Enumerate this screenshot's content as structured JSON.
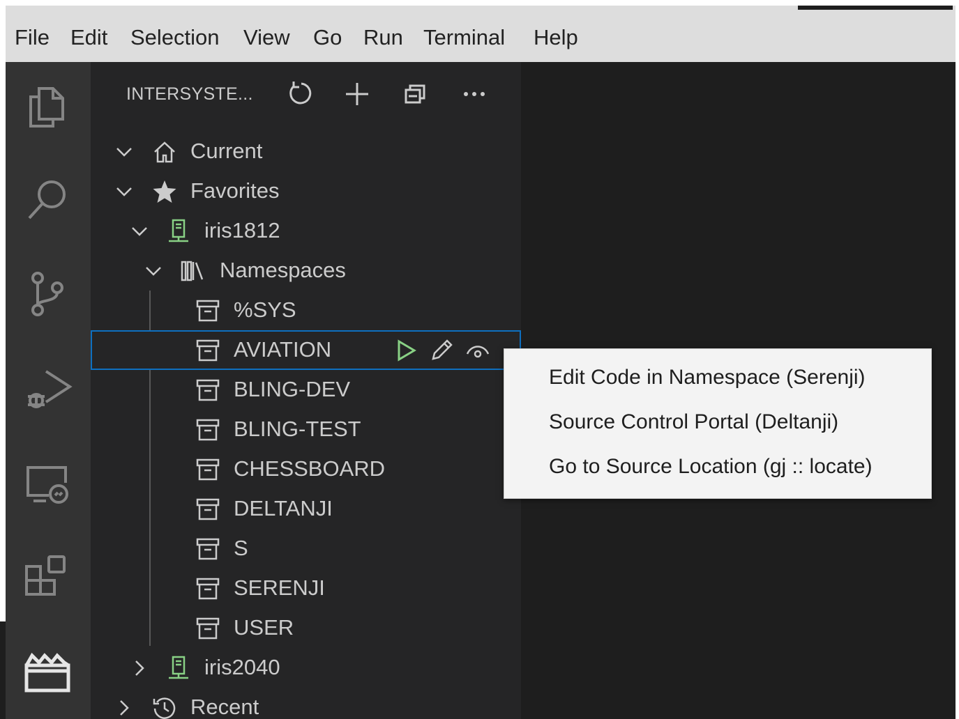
{
  "menu": [
    "File",
    "Edit",
    "Selection",
    "View",
    "Go",
    "Run",
    "Terminal",
    "Help"
  ],
  "activity_bar": [
    {
      "name": "explorer-icon"
    },
    {
      "name": "search-icon"
    },
    {
      "name": "source-control-icon"
    },
    {
      "name": "run-debug-icon"
    },
    {
      "name": "remote-explorer-icon"
    },
    {
      "name": "extensions-icon"
    },
    {
      "name": "intersystems-tools-icon"
    }
  ],
  "sidebar": {
    "title": "INTERSYSTE...",
    "actions": [
      "refresh-icon",
      "add-icon",
      "collapse-all-icon",
      "more-actions-icon"
    ],
    "tree": [
      {
        "label": "Current",
        "icon": "home-icon",
        "chevron": "expanded"
      },
      {
        "label": "Favorites",
        "icon": "star-icon",
        "chevron": "expanded"
      },
      {
        "label": "iris1812",
        "icon": "server-icon",
        "chevron": "expanded"
      },
      {
        "label": "Namespaces",
        "icon": "library-icon",
        "chevron": "expanded"
      },
      {
        "label": "%SYS",
        "icon": "archive-icon"
      },
      {
        "label": "AVIATION",
        "icon": "archive-icon",
        "selected": true
      },
      {
        "label": "BLING-DEV",
        "icon": "archive-icon"
      },
      {
        "label": "BLING-TEST",
        "icon": "archive-icon"
      },
      {
        "label": "CHESSBOARD",
        "icon": "archive-icon"
      },
      {
        "label": "DELTANJI",
        "icon": "archive-icon"
      },
      {
        "label": "S",
        "icon": "archive-icon"
      },
      {
        "label": "SERENJI",
        "icon": "archive-icon"
      },
      {
        "label": "USER",
        "icon": "archive-icon"
      },
      {
        "label": "iris2040",
        "icon": "server-icon",
        "chevron": "collapsed"
      },
      {
        "label": "Recent",
        "icon": "history-icon",
        "chevron": "collapsed"
      }
    ]
  },
  "context_menu": {
    "items": [
      "Edit Code in Namespace (Serenji)",
      "Source Control Portal (Deltanji)",
      "Go to Source Location (gj :: locate)"
    ]
  },
  "colors": {
    "server_icon": "#89d185",
    "run_icon": "#89d185",
    "selection_border": "#0e70c0",
    "menubar_bg": "#dddddd",
    "context_menu_bg": "#f3f3f3"
  }
}
